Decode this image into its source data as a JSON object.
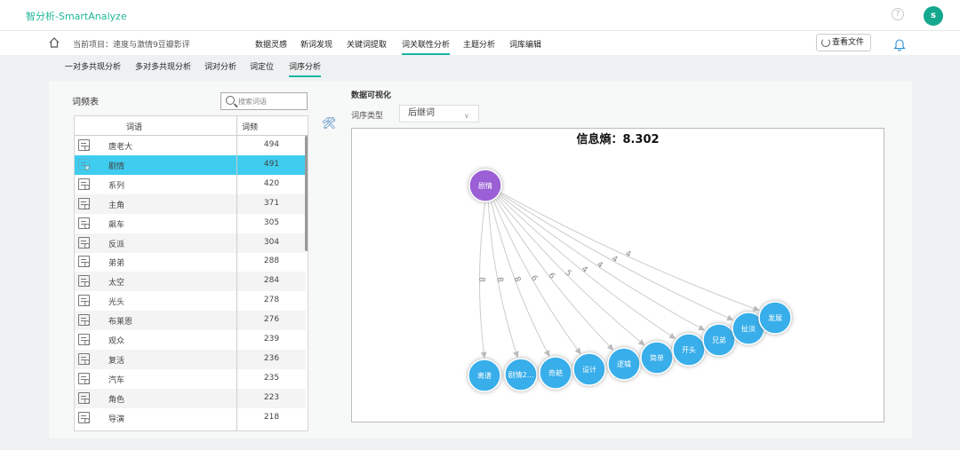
{
  "app": {
    "title": "智分析-SmartAnalyze",
    "user_initial": "s"
  },
  "header": {
    "help_icon": "question-circle-icon"
  },
  "nav1": {
    "project": "当前项目：速度与激情9豆瓣影评",
    "items": [
      "数据灵感",
      "新词发现",
      "关键词提取",
      "词关联性分析",
      "主题分析",
      "词库编辑"
    ],
    "active_index": 3,
    "view_file_label": "查看文件"
  },
  "nav2": {
    "items": [
      "一对多共现分析",
      "多对多共现分析",
      "词对分析",
      "词定位",
      "词序分析"
    ],
    "active_index": 4
  },
  "freq_table": {
    "title": "词频表",
    "search_placeholder": "搜索词语",
    "headers": [
      "词语",
      "词频"
    ],
    "selected_index": 1,
    "rows": [
      {
        "term": "唐老大",
        "freq": "494"
      },
      {
        "term": "剧情",
        "freq": "491"
      },
      {
        "term": "系列",
        "freq": "420"
      },
      {
        "term": "主角",
        "freq": "371"
      },
      {
        "term": "飙车",
        "freq": "305"
      },
      {
        "term": "反派",
        "freq": "304"
      },
      {
        "term": "弟弟",
        "freq": "288"
      },
      {
        "term": "太空",
        "freq": "284"
      },
      {
        "term": "光头",
        "freq": "278"
      },
      {
        "term": "布莱恩",
        "freq": "276"
      },
      {
        "term": "观众",
        "freq": "239"
      },
      {
        "term": "复活",
        "freq": "236"
      },
      {
        "term": "汽车",
        "freq": "235"
      },
      {
        "term": "角色",
        "freq": "223"
      },
      {
        "term": "导演",
        "freq": "218"
      }
    ]
  },
  "viz": {
    "title": "数据可视化",
    "type_label": "词序类型",
    "type_value": "后继词",
    "entropy": "信息熵：8.302",
    "source_node": "剧情",
    "node_color": "#38aeea",
    "source_color": "#9b5fd6",
    "targets": [
      {
        "label": "离谱",
        "weight": "8"
      },
      {
        "label": "剧情2...",
        "weight": "8"
      },
      {
        "label": "奇葩",
        "weight": "8"
      },
      {
        "label": "设计",
        "weight": "6"
      },
      {
        "label": "逻辑",
        "weight": "6"
      },
      {
        "label": "简单",
        "weight": "5"
      },
      {
        "label": "开头",
        "weight": "4"
      },
      {
        "label": "兄弟",
        "weight": "4"
      },
      {
        "label": "扯淡",
        "weight": "4"
      },
      {
        "label": "发展",
        "weight": "4"
      }
    ]
  }
}
